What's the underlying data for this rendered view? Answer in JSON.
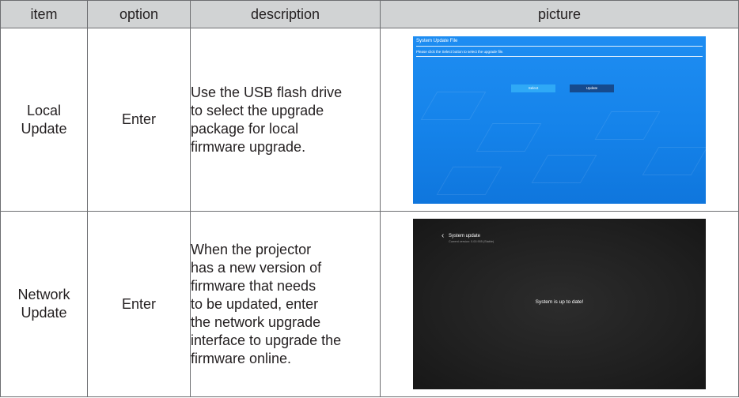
{
  "table": {
    "headers": [
      "item",
      "option",
      "description",
      "picture"
    ],
    "rows": [
      {
        "item_lines": [
          "Local",
          "Update"
        ],
        "option": "Enter",
        "description_lines": [
          "Use the USB flash drive",
          "to select the upgrade",
          "package for local",
          "firmware upgrade."
        ]
      },
      {
        "item_lines": [
          "Network",
          "Update"
        ],
        "option": "Enter",
        "description_lines": [
          "When the projector",
          "has a new version of",
          "firmware that needs",
          "to be updated, enter",
          "the network upgrade",
          "interface to upgrade the",
          "firmware online."
        ]
      }
    ]
  },
  "screen_local": {
    "title": "System Update File",
    "instruction": "Please click the Select button to select the upgrade file.",
    "select_button": "Select",
    "update_button": "Update"
  },
  "screen_network": {
    "back_icon": "chevron-left-icon",
    "title": "System update",
    "current_version": "Current version: 0.00.905 (Stable)",
    "message": "System is up to date!"
  },
  "colors": {
    "header_bg": "#d1d3d4",
    "border": "#6d6e71",
    "local_screen_bg": "#1583ea",
    "network_screen_bg": "#202020"
  }
}
